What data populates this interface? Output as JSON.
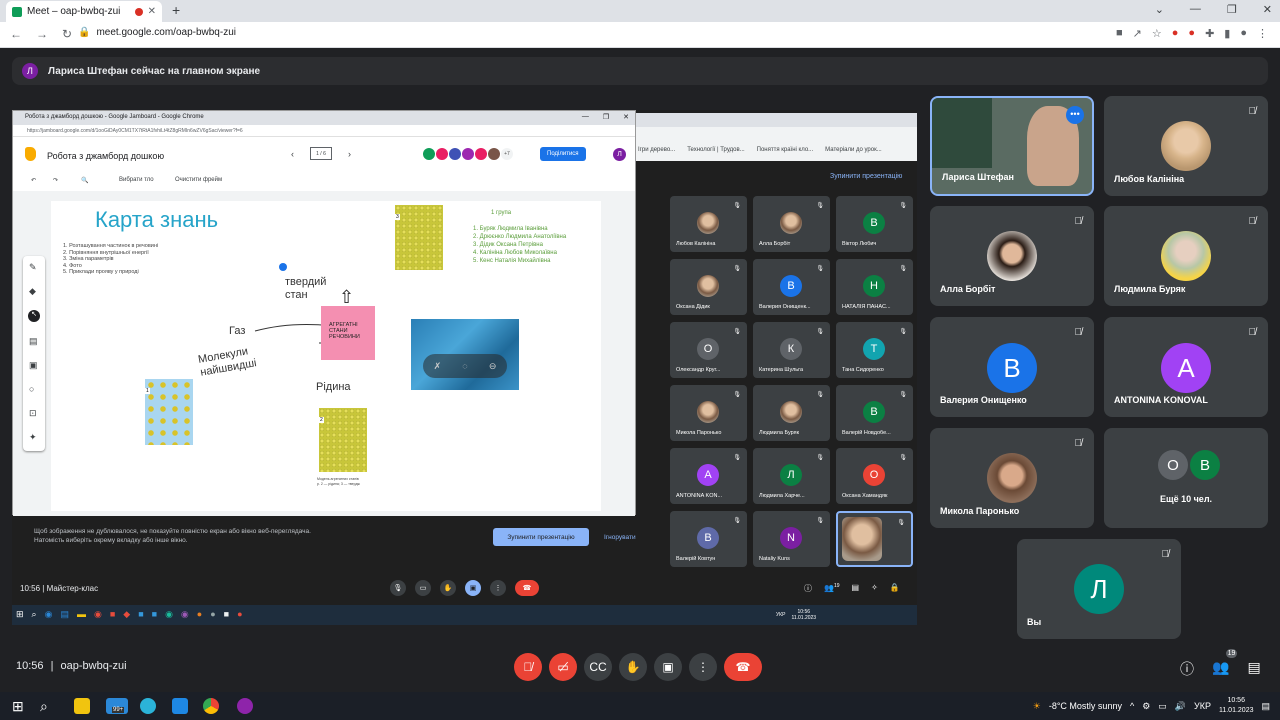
{
  "browser": {
    "tab_title": "Meet – oap-bwbq-zui",
    "new_tab": "+",
    "url": "meet.google.com/oap-bwbq-zui"
  },
  "banner": {
    "avatar_letter": "Л",
    "text": "Лариса Штефан сейчас на главном экране"
  },
  "jamboard": {
    "window_title": "Робота з джамборд дошкою - Google Jamboard - Google Chrome",
    "url": "https://jamboard.google.com/d/1ooGiDAy0CM1TX7tRtA1fvhiLt4tZ8gRMIn6wZV6gSac/viewer?f=6",
    "doc_title": "Робота з джамборд дошкою",
    "page_indicator": "1 / 6",
    "more_count": "+7",
    "share_label": "Поділитися",
    "me_letter": "Л",
    "tool_select_bg": "Вибрати тло",
    "tool_clear": "Очистити фрейм",
    "board": {
      "title": "Карта знань",
      "list": [
        "1. Розташування частинок в речовині",
        "2. Порівняння внутрішньої енергії",
        "3. Зміна параметрів",
        "4. Фото",
        "5. Приклади прояву у природі"
      ],
      "group_title": "1 група",
      "group_members": [
        "1.   Буряк Людмила Іванівна",
        "2.   Дрюєнко Людмила Анатоліївна",
        "3.   Дідик Оксана Петрівна",
        "4.   Калініна Любов Миколаївна",
        "5.   Кенс Наталія Михайлівна"
      ],
      "solid": "твердий\nстан",
      "gas": "Газ",
      "molecules": "Молекули\nнайшвидші",
      "liquid": "Рідина",
      "sticky": "АГРЕГАТНІ\nСТАНИ\nРЕЧОВИНИ",
      "caption": "Модель агрегатних станів\nр. 2 — рідина; 3 — твердж",
      "img_num_1": "1",
      "img_num_2": "2",
      "img_num_3": "3"
    }
  },
  "share_notice": {
    "text": "Щоб зображення не дублювалося, не показуйте повністю екран або вікно веб-переглядача. Натомість виберіть окрему вкладку або інше вікно.",
    "stop_button": "Зупинити презентацію",
    "ignore_button": "Ігнорувати",
    "stop_top": "Зупинити презентацію"
  },
  "bg_window": {
    "bookmarks": [
      "Ігри дерево...",
      "Технології | Трудов...",
      "Поняття країні кло...",
      "Матеріали до урок..."
    ]
  },
  "inner_grid": [
    {
      "name": "Любов Калініна",
      "letter": "",
      "color": "#3c4043",
      "photo": true
    },
    {
      "name": "Алла Борбіт",
      "letter": "",
      "color": "#3c4043",
      "photo": true
    },
    {
      "name": "Віктор Любич",
      "letter": "В",
      "color": "#0b8043"
    },
    {
      "name": "Оксана Дідик",
      "letter": "",
      "color": "#3c4043",
      "photo": true
    },
    {
      "name": "Валерия Онищенк...",
      "letter": "В",
      "color": "#1a73e8"
    },
    {
      "name": "НАТАЛІЯ ПАНАС...",
      "letter": "Н",
      "color": "#0b8043"
    },
    {
      "name": "Олександр Круг...",
      "letter": "О",
      "color": "#5f6368"
    },
    {
      "name": "Катерина Шульга",
      "letter": "К",
      "color": "#5f6368"
    },
    {
      "name": "Тана Сидоренко",
      "letter": "Т",
      "color": "#12a4af"
    },
    {
      "name": "Микола Паронько",
      "letter": "",
      "color": "#3c4043",
      "photo": true
    },
    {
      "name": "Людмила Буряк",
      "letter": "",
      "color": "#3c4043",
      "photo": true
    },
    {
      "name": "Валерій Новдобе...",
      "letter": "В",
      "color": "#0b8043"
    },
    {
      "name": "ANTONINA KON...",
      "letter": "А",
      "color": "#a142f4"
    },
    {
      "name": "Людмила Харче...",
      "letter": "Л",
      "color": "#0b8043"
    },
    {
      "name": "Оксана Хамандяк",
      "letter": "О",
      "color": "#ea4335"
    },
    {
      "name": "Валерій Ковтун",
      "letter": "В",
      "color": "#5f6aa8"
    },
    {
      "name": "Nataliy Kuns",
      "letter": "N",
      "color": "#7b1fa2"
    },
    {
      "name": "",
      "letter": "",
      "color": "#3c4043",
      "photo": true
    }
  ],
  "inner_bar": {
    "time": "10:56",
    "separator": "|",
    "title": "Майстер-клас",
    "count": "19"
  },
  "inner_taskbar": {
    "lang": "УКР",
    "time": "10:56",
    "date": "11.01.2023"
  },
  "tiles": [
    {
      "name": "Лариса Штефан",
      "type": "video"
    },
    {
      "name": "Любов Калініна",
      "type": "photo"
    },
    {
      "name": "Алла Борбіт",
      "type": "photo"
    },
    {
      "name": "Людмила Буряк",
      "type": "photo"
    },
    {
      "name": "Валерия Онищенко",
      "type": "letter",
      "letter": "В",
      "color": "#1a73e8"
    },
    {
      "name": "ANTONINA KONOVAL",
      "type": "letter",
      "letter": "A",
      "color": "#a142f4"
    },
    {
      "name": "Микола Паронько",
      "type": "photo"
    },
    {
      "name": "Ещё 10 чел.",
      "type": "more",
      "letters": [
        "О",
        "В"
      ]
    },
    {
      "name": "Вы",
      "type": "letter",
      "letter": "Л",
      "color": "#00897b"
    }
  ],
  "bottom": {
    "time": "10:56",
    "separator": "|",
    "meeting_code": "oap-bwbq-zui",
    "participants_count": "19"
  },
  "taskbar": {
    "badge": "99+",
    "weather": "-8°C  Mostly sunny",
    "lang": "УКР",
    "time": "10:56",
    "date": "11.01.2023"
  }
}
